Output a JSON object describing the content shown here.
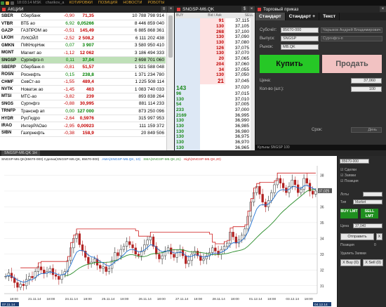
{
  "topbar": {
    "time": "18:03:14 MSK",
    "user": "charikov_a",
    "menu": [
      "КОТИРОВКИ",
      "ПОЗИЦИЯ",
      "НОВОСТИ",
      "РОБОТЫ"
    ]
  },
  "quotes": {
    "title": "АКЦИИ",
    "rows": [
      [
        "SBER",
        "Сбербанк",
        "-0,90",
        "71,35",
        "10 788 798 914",
        "neg"
      ],
      [
        "VTBR",
        "ВТБ ао",
        "6,92",
        "0,05266",
        "8 446 859 040",
        "pos"
      ],
      [
        "GAZP",
        "ГАЗПРОМ ао",
        "-0,51",
        "145,49",
        "6 885 868 361",
        "neg"
      ],
      [
        "LKOH",
        "ЛУКОЙЛ",
        "-2,52",
        "2 508,2",
        "6 111 202 438",
        "neg"
      ],
      [
        "GMKN",
        "ГМКНорНик",
        "0,07",
        "3 907",
        "3 580 950 410",
        "pos"
      ],
      [
        "MGNT",
        "Магнит ао",
        "-1,12",
        "12 062",
        "3 186 494 333",
        "neg"
      ],
      [
        "SNGSP",
        "Сургнфгз-п",
        "0,11",
        "37,04",
        "2 698 701 060",
        "pos"
      ],
      [
        "SBERP",
        "Сбербанк-п",
        "-0,81",
        "51,57",
        "1 921 588 048",
        "neg"
      ],
      [
        "ROSN",
        "Роснефть",
        "0,15",
        "238,8",
        "1 371 234 780",
        "pos"
      ],
      [
        "CHMF",
        "СевСт-ао",
        "-1,55",
        "489,4",
        "1 225 508 114",
        "neg"
      ],
      [
        "NVTK",
        "Новатэк ао",
        "-1,45",
        "463",
        "1 083 740 033",
        "neg"
      ],
      [
        "MTSI",
        "МТС-ао",
        "-3,82",
        "239",
        "893 838 264",
        "neg"
      ],
      [
        "SNGS",
        "Сургнфгз",
        "-0,88",
        "30,995",
        "881 114 233",
        "neg"
      ],
      [
        "TRNFP",
        "Транснф ап",
        "0,00",
        "127 000",
        "873 250 096",
        "pos"
      ],
      [
        "HYDR",
        "РусГидро",
        "-2,64",
        "0,5976",
        "315 997 953",
        "neg"
      ],
      [
        "IRAO",
        "ИнтерРАОао",
        "-2,95",
        "0,00923",
        "111 159 372",
        "neg"
      ],
      [
        "SIBN",
        "Газпрнефть",
        "-0,38",
        "158,9",
        "20 849 506",
        "neg"
      ]
    ]
  },
  "depth": {
    "title": "SNGSP-M6.QK",
    "hdr": [
      "BUY",
      "Bid / Ask",
      "SELL"
    ],
    "asks": [
      [
        "91",
        "37,115"
      ],
      [
        "130",
        "37,105"
      ],
      [
        "268",
        "37,100"
      ],
      [
        "130",
        "37,090"
      ],
      [
        "130",
        "37,080"
      ],
      [
        "126",
        "37,075"
      ],
      [
        "130",
        "37,070"
      ],
      [
        "20",
        "37,065"
      ],
      [
        "204",
        "37,060"
      ],
      [
        "34",
        "37,055"
      ],
      [
        "130",
        "37,050"
      ],
      [
        "21",
        "37,045"
      ]
    ],
    "bids": [
      [
        "143",
        "37,020"
      ],
      [
        "96",
        "37,015"
      ],
      [
        "130",
        "37,010"
      ],
      [
        "54",
        "37,005"
      ],
      [
        "233",
        "37,000"
      ],
      [
        "2169",
        "36,995"
      ],
      [
        "130",
        "36,990"
      ],
      [
        "130",
        "36,985"
      ],
      [
        "130",
        "36,980"
      ],
      [
        "130",
        "36,975"
      ],
      [
        "130",
        "36,970"
      ],
      [
        "130",
        "36,965"
      ],
      [
        "130",
        "36,960"
      ]
    ]
  },
  "order": {
    "title": "Торговый приказ",
    "tabs": [
      "Стандарт",
      "Стандарт +",
      "Текст"
    ],
    "labels": {
      "account": "Субсчёт:",
      "issue": "Выпуск:",
      "market": "Рынок:",
      "price": "Цена:",
      "qty": "Кол-во (шт.):",
      "term": "Срок:"
    },
    "values": {
      "account": "85670-000",
      "account_name": "Чарыков Андрей Владимирович",
      "issue": "SNGSP",
      "issue_name": "Сургнфгз-п",
      "market": "MB.QK",
      "price": "37,060",
      "qty": "100",
      "term": "День"
    },
    "buy": "Купить",
    "sell": "Продать",
    "status": "Кульны SNGSP 100"
  },
  "chart": {
    "tab": "SNGSP-M6.QK 1H",
    "title": "SNGSP-M6.QK",
    "legend": [
      [
        "SNGSP-M6.QK(85670-000) Сделки(SNGSP-M6.QK, 85670-000)",
        "#222"
      ],
      [
        "AMA(SNGSP-M6.QK, 10)",
        "#1e6fd0"
      ],
      [
        "SMA(SNGSP-M6.QK,21)",
        "#2a8c2a"
      ],
      [
        "High(SNGSP-M6.QK,20)",
        "#d02020"
      ]
    ],
    "yticks": [
      "38",
      "37",
      "36",
      "35",
      "34",
      "33",
      "32",
      "31"
    ],
    "xticks": [
      "18:00",
      "21.11.14",
      "18:00",
      "24.11.14",
      "18:00",
      "25.11.14",
      "18:00",
      "26.11.14",
      "18:00",
      "27.11.14",
      "18:00",
      "28.11.14",
      "18:00",
      "01.12.14",
      "18:00",
      "03.12.14",
      "18:00"
    ],
    "xstart": "07.11.14",
    "xend": "04.12.14",
    "lastprice": "37,025",
    "ymin": 30.5,
    "ymax": 38.6,
    "close": [
      31.6,
      31.8,
      31.5,
      31.2,
      30.9,
      31.1,
      31.0,
      31.4,
      31.6,
      31.5,
      31.9,
      32.2,
      32.0,
      31.8,
      31.9,
      32.1,
      31.7,
      31.6,
      31.4,
      31.7,
      31.9,
      32.6,
      33.4,
      34.0,
      34.3,
      33.6,
      33.2,
      32.8,
      32.4,
      32.5,
      32.7,
      32.3,
      32.1,
      32.2,
      31.9,
      32.1,
      32.6,
      33.1,
      32.9,
      33.3,
      33.5,
      33.8,
      33.6,
      33.4,
      33.0,
      32.9,
      33.2,
      33.6,
      33.9,
      34.1,
      33.5,
      33.0,
      32.7,
      32.9,
      33.2,
      33.4,
      33.0,
      32.8,
      33.1,
      33.3,
      32.9,
      32.4,
      32.6,
      33.0,
      33.2,
      32.9,
      32.6,
      32.7,
      32.9,
      33.1,
      33.4,
      33.2,
      33.0,
      33.3,
      33.5,
      33.7,
      34.4,
      34.1,
      33.7,
      33.9,
      34.2,
      34.6,
      35.4,
      36.3,
      36.9,
      37.3,
      36.8,
      36.3,
      36.0,
      36.4,
      36.9,
      37.4,
      37.8,
      37.5,
      37.2,
      36.9,
      37.3,
      37.7,
      37.4,
      36.9,
      37.1,
      37.8,
      37.5,
      37.0,
      36.8,
      37.0
    ]
  },
  "side": {
    "account": "85670-000",
    "opts": [
      "Сделки",
      "Заявки",
      "Позиция"
    ],
    "lots": "Лоты",
    "type": "Тип",
    "mkt": "Market",
    "bl": "BUY LMT",
    "sl": "SELL LMT",
    "price": "Цена",
    "priceval": "37,040",
    "send": "Отправить",
    "x": "X",
    "pos": "Позиция",
    "posv": "0",
    "del": "Удалить Заявки",
    "buyb": "X Buy (0)",
    "sellb": "X Sell (0)"
  }
}
